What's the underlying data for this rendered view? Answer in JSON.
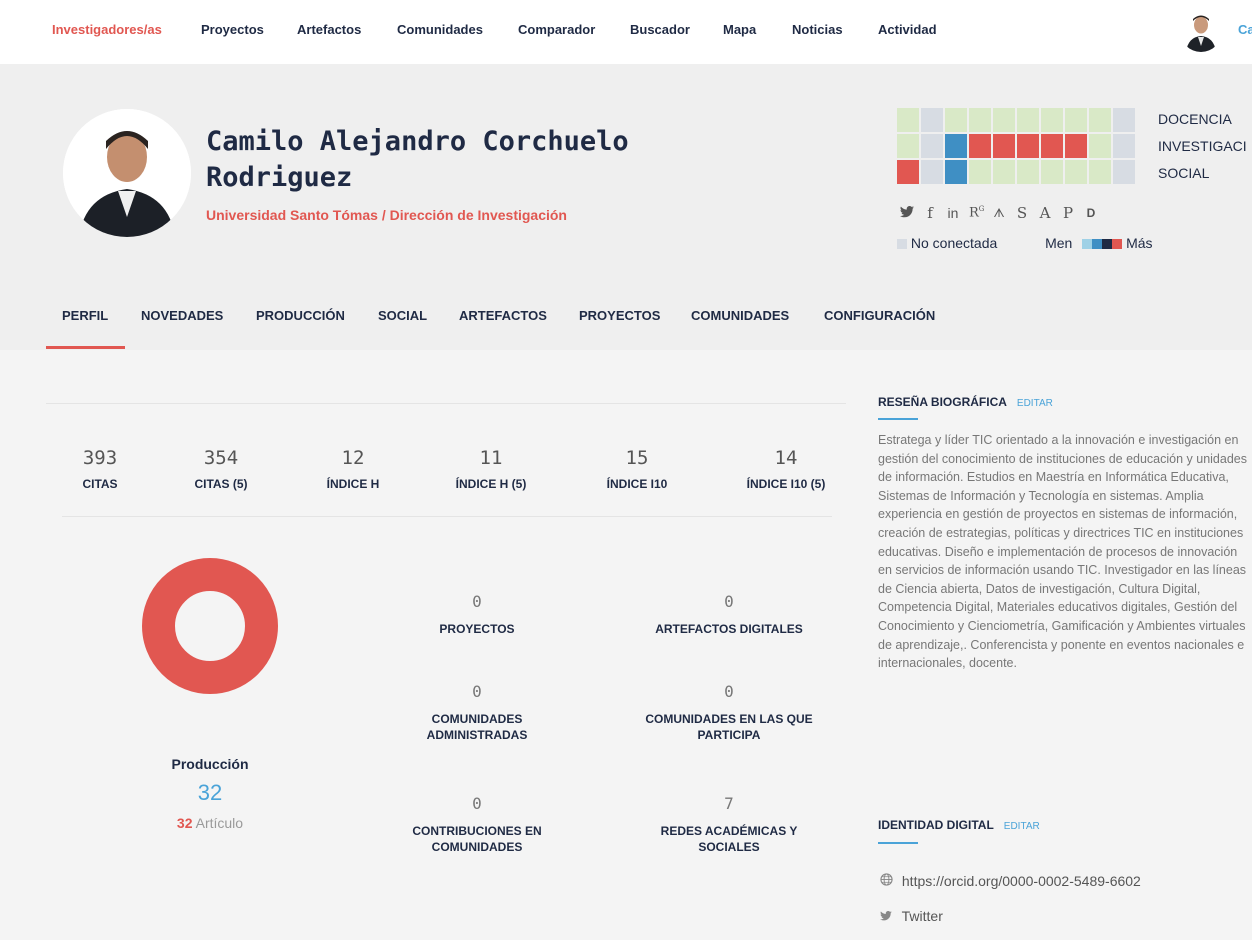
{
  "nav": {
    "items": [
      "Investigadores/as",
      "Proyectos",
      "Artefactos",
      "Comunidades",
      "Comparador",
      "Buscador",
      "Mapa",
      "Noticias",
      "Actividad"
    ],
    "active_index": 0,
    "user_label": "Ca"
  },
  "profile": {
    "name_line1": "Camilo Alejandro Corchuelo",
    "name_line2": "Rodriguez",
    "affiliation": "Universidad Santo Tómas / Dirección de Investigación"
  },
  "activity": {
    "rows": [
      "DOCENCIA",
      "INVESTIGACI",
      "SOCIAL"
    ],
    "social_icons": [
      {
        "name": "twitter-icon",
        "glyph": "🐦"
      },
      {
        "name": "facebook-icon",
        "glyph": "f"
      },
      {
        "name": "linkedin-icon",
        "glyph": "in"
      },
      {
        "name": "researchgate-icon",
        "glyph": "Rᴳ"
      },
      {
        "name": "mendeley-icon",
        "glyph": "ᗑ"
      },
      {
        "name": "google-scholar-icon",
        "glyph": "S"
      },
      {
        "name": "academia-icon",
        "glyph": "A"
      },
      {
        "name": "publons-icon",
        "glyph": "P"
      },
      {
        "name": "orcid-icon",
        "glyph": "D"
      }
    ],
    "legend_disconnected": "No conectada",
    "legend_less": "Men",
    "legend_more": "Más",
    "colors": {
      "empty": "#d9e9c7",
      "off": "#d7dce3",
      "blue": "#3f8fc4",
      "red": "#e15751"
    }
  },
  "tabs": [
    "PERFIL",
    "NOVEDADES",
    "PRODUCCIÓN",
    "SOCIAL",
    "ARTEFACTOS",
    "PROYECTOS",
    "COMUNIDADES",
    "CONFIGURACIÓN"
  ],
  "metrics": [
    {
      "value": "393",
      "label": "CITAS"
    },
    {
      "value": "354",
      "label": "CITAS (5)"
    },
    {
      "value": "12",
      "label": "ÍNDICE H"
    },
    {
      "value": "11",
      "label": "ÍNDICE H (5)"
    },
    {
      "value": "15",
      "label": "ÍNDICE I10"
    },
    {
      "value": "14",
      "label": "ÍNDICE I10 (5)"
    }
  ],
  "production": {
    "title": "Producción",
    "count": "32",
    "article_count": "32",
    "article_label": "Artículo"
  },
  "stats": [
    {
      "value": "0",
      "label": "PROYECTOS"
    },
    {
      "value": "0",
      "label": "ARTEFACTOS DIGITALES"
    },
    {
      "value": "0",
      "label": "COMUNIDADES ADMINISTRADAS"
    },
    {
      "value": "0",
      "label": "COMUNIDADES EN LAS QUE PARTICIPA"
    },
    {
      "value": "0",
      "label": "CONTRIBUCIONES EN COMUNIDADES"
    },
    {
      "value": "7",
      "label": "REDES ACADÉMICAS Y SOCIALES"
    }
  ],
  "bio": {
    "title": "RESEÑA BIOGRÁFICA",
    "edit": "EDITAR",
    "text": "Estratega y líder TIC orientado a la innovación e investigación en gestión del conocimiento de instituciones de educación y unidades de información. Estudios en Maestría en Informática Educativa, Sistemas de Información y Tecnología en sistemas. Amplia experiencia en gestión de proyectos en sistemas de información, creación de estrategias, políticas y directrices TIC en instituciones educativas. Diseño e implementación de procesos de innovación en servicios de información usando TIC. Investigador en las líneas de Ciencia abierta, Datos de investigación, Cultura Digital, Competencia Digital, Materiales educativos digitales, Gestión del Conocimiento y Cienciometría, Gamificación y Ambientes virtuales de aprendizaje,. Conferencista y ponente en eventos nacionales e internacionales, docente."
  },
  "digital_identity": {
    "title": "IDENTIDAD DIGITAL",
    "edit": "EDITAR",
    "links": [
      {
        "icon": "globe-icon",
        "text": "https://orcid.org/0000-0002-5489-6602"
      },
      {
        "icon": "twitter-icon",
        "text": "Twitter"
      }
    ]
  }
}
